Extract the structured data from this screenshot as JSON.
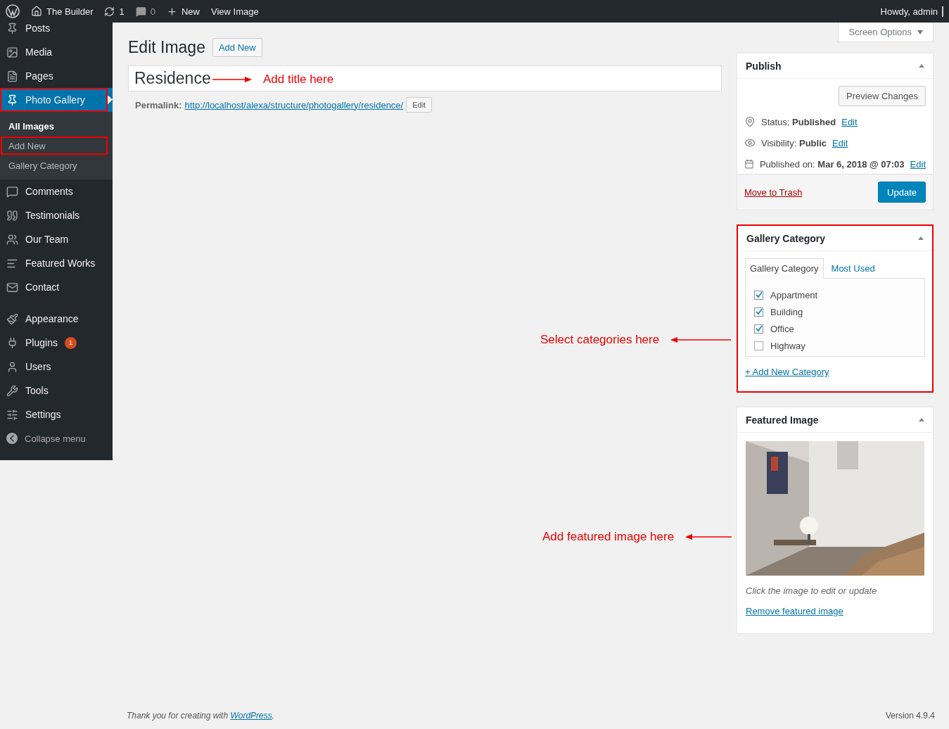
{
  "admin_bar": {
    "site": "The Builder",
    "updates": "1",
    "comments": "0",
    "new": "New",
    "view": "View Image",
    "greeting": "Howdy, admin"
  },
  "sidebar": {
    "items": [
      {
        "kind": "pin",
        "label": "Posts",
        "selected": false,
        "highlighted": false
      },
      {
        "kind": "media",
        "label": "Media",
        "selected": false,
        "highlighted": false
      },
      {
        "kind": "page",
        "label": "Pages",
        "selected": false,
        "highlighted": false
      },
      {
        "kind": "pin",
        "label": "Photo Gallery",
        "selected": true,
        "highlighted": true,
        "children": [
          {
            "label": "All Images",
            "selected": true,
            "highlighted": false
          },
          {
            "label": "Add New",
            "selected": false,
            "highlighted": true
          },
          {
            "label": "Gallery Category",
            "selected": false,
            "highlighted": false
          }
        ]
      },
      {
        "kind": "comment",
        "label": "Comments",
        "selected": false,
        "highlighted": false
      },
      {
        "kind": "quote",
        "label": "Testimonials",
        "selected": false,
        "highlighted": false
      },
      {
        "kind": "team",
        "label": "Our Team",
        "selected": false,
        "highlighted": false
      },
      {
        "kind": "list",
        "label": "Featured Works",
        "selected": false,
        "highlighted": false
      },
      {
        "kind": "mail",
        "label": "Contact",
        "selected": false,
        "highlighted": false
      },
      {
        "kind": "separator"
      },
      {
        "kind": "brush",
        "label": "Appearance",
        "selected": false,
        "highlighted": false
      },
      {
        "kind": "plug",
        "label": "Plugins",
        "selected": false,
        "highlighted": false,
        "badge": "1"
      },
      {
        "kind": "user",
        "label": "Users",
        "selected": false,
        "highlighted": false
      },
      {
        "kind": "wrench",
        "label": "Tools",
        "selected": false,
        "highlighted": false
      },
      {
        "kind": "sliders",
        "label": "Settings",
        "selected": false,
        "highlighted": false
      }
    ],
    "collapse": "Collapse menu"
  },
  "screen_options": "Screen Options",
  "heading": "Edit Image",
  "add_new": "Add New",
  "title_field": {
    "value": "Residence"
  },
  "permalink": {
    "label": "Permalink:",
    "url": "http://localhost/alexa/structure/photogallery/residence/",
    "button": "Edit"
  },
  "annotations": [
    {
      "kind": "title",
      "text": "Add title here"
    },
    {
      "kind": "categories",
      "text": "Select categories here"
    },
    {
      "text": "Add featured image here"
    }
  ],
  "publish": {
    "title": "Publish",
    "preview": "Preview Changes",
    "rows": [
      {
        "kind": "pin",
        "label": "Status:",
        "value": "Published",
        "link": "Edit"
      },
      {
        "kind": "eye",
        "label": "Visibility:",
        "value": "Public",
        "link": "Edit"
      },
      {
        "kind": "calendar",
        "label": "Published on:",
        "value": "Mar 6, 2018 @ 07:03",
        "link": "Edit"
      }
    ],
    "trash": "Move to Trash",
    "update": "Update"
  },
  "gallery_category": {
    "title": "Gallery Category",
    "highlighted": true,
    "tabs": [
      {
        "label": "Gallery Category",
        "selected": true
      },
      {
        "label": "Most Used",
        "selected": false
      }
    ],
    "items": [
      {
        "label": "Appartment",
        "checked": true
      },
      {
        "label": "Building",
        "checked": true
      },
      {
        "label": "Office",
        "checked": true
      },
      {
        "label": "Highway",
        "checked": false
      }
    ],
    "add_link": "+ Add New Category"
  },
  "featured_image": {
    "title": "Featured Image",
    "hint": "Click the image to edit or update",
    "remove": "Remove featured image"
  },
  "footer": {
    "text": "Thank you for creating with ",
    "link": "WordPress",
    "after": ".",
    "version": "Version 4.9.4"
  }
}
